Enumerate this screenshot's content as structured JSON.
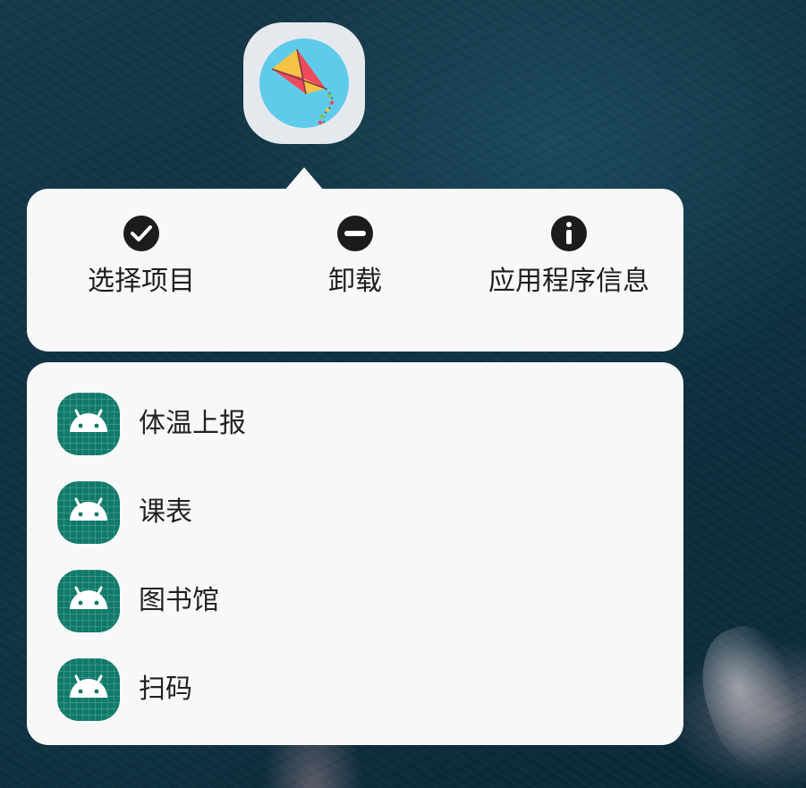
{
  "app": {
    "icon": "kite-app-icon",
    "colors": {
      "icon_bg": "#e5e9ee",
      "icon_circle": "#5ecbea",
      "kite_red": "#ef4a5e",
      "kite_yellow": "#f6c445",
      "kite_tail": "#5c4033"
    }
  },
  "actions": [
    {
      "icon": "check-circle-icon",
      "label": "选择项目"
    },
    {
      "icon": "minus-circle-icon",
      "label": "卸载"
    },
    {
      "icon": "info-circle-icon",
      "label": "应用程序信息"
    }
  ],
  "shortcuts": [
    {
      "icon": "android-icon",
      "label": "体温上报"
    },
    {
      "icon": "android-icon",
      "label": "课表"
    },
    {
      "icon": "android-icon",
      "label": "图书馆"
    },
    {
      "icon": "android-icon",
      "label": "扫码"
    }
  ],
  "colors": {
    "card_bg": "#f8f8fa",
    "shortcut_icon_bg": "#107a6a",
    "text": "#1e1e1e"
  }
}
